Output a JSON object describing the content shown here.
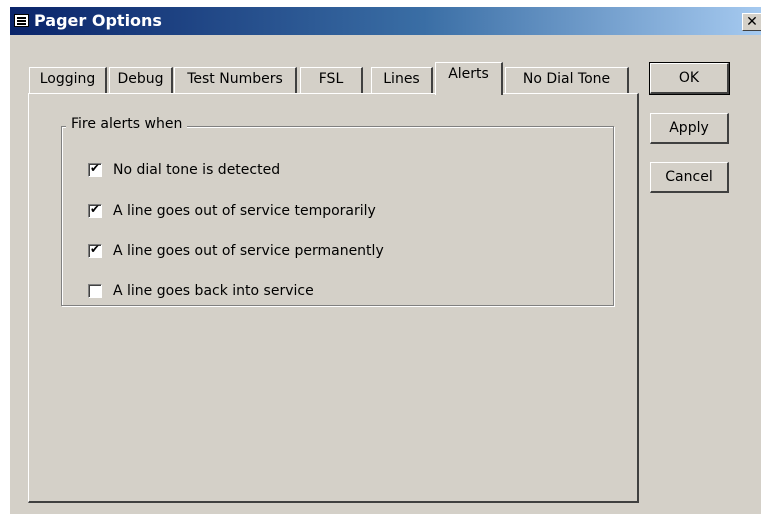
{
  "window": {
    "title": "Pager Options",
    "close_label": "✕"
  },
  "tabs": [
    {
      "label": "Logging",
      "active": false
    },
    {
      "label": "Debug",
      "active": false
    },
    {
      "label": "Test Numbers",
      "active": false
    },
    {
      "label": "FSL",
      "active": false
    },
    {
      "label": "Lines",
      "active": false
    },
    {
      "label": "Alerts",
      "active": true
    },
    {
      "label": "No Dial Tone",
      "active": false
    }
  ],
  "alerts_group": {
    "legend": "Fire alerts when",
    "options": [
      {
        "label": "No dial tone is detected",
        "checked": true
      },
      {
        "label": "A line goes out of service temporarily",
        "checked": true
      },
      {
        "label": "A line goes out of service permanently",
        "checked": true
      },
      {
        "label": "A line goes back into service",
        "checked": false
      }
    ]
  },
  "buttons": {
    "ok": "OK",
    "apply": "Apply",
    "cancel": "Cancel"
  },
  "colors": {
    "dialog_face": "#d4d0c8",
    "titlebar_start": "#0a246a",
    "titlebar_end": "#a6caf0"
  }
}
